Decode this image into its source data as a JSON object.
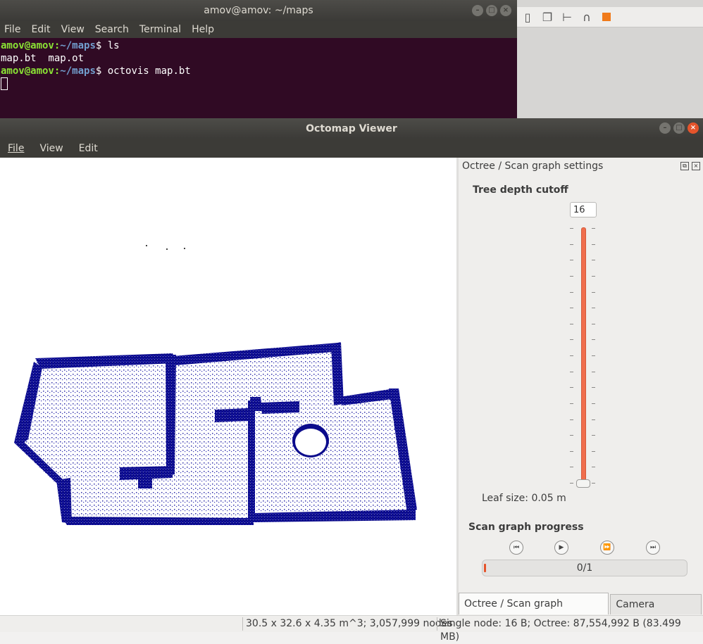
{
  "terminal": {
    "title": "amov@amov: ~/maps",
    "menu": [
      "File",
      "Edit",
      "View",
      "Search",
      "Terminal",
      "Help"
    ],
    "lines": [
      {
        "user": "amov@amov",
        "sep": ":",
        "path": "~/maps",
        "prompt": "$ ",
        "cmd": "ls"
      },
      {
        "output": "map.bt  map.ot"
      },
      {
        "user": "amov@amov",
        "sep": ":",
        "path": "~/maps",
        "prompt": "$ ",
        "cmd": "octovis map.bt"
      }
    ]
  },
  "viewer": {
    "title": "Octomap Viewer",
    "menu": {
      "file": "File",
      "view": "View",
      "edit": "Edit"
    },
    "dock": {
      "title": "Octree / Scan graph settings",
      "tree_depth_label": "Tree depth cutoff",
      "tree_depth_value": "16",
      "leaf_size_label": "Leaf size:",
      "leaf_size_value": "0.05 m",
      "scan_progress_label": "Scan graph progress",
      "progress_text": "0/1",
      "progress_fraction": 0
    },
    "tabs": [
      "Octree / Scan graph settings",
      "Camera settings"
    ],
    "status": {
      "left": "30.5 x 32.6 x 4.35 m^3; 3,057,999 nodes",
      "right": "Single node: 16 B; Octree: 87,554,992 B (83.499 MB)"
    },
    "colors": {
      "occupied": "#0b0b8c",
      "accent": "#e5542b"
    }
  }
}
